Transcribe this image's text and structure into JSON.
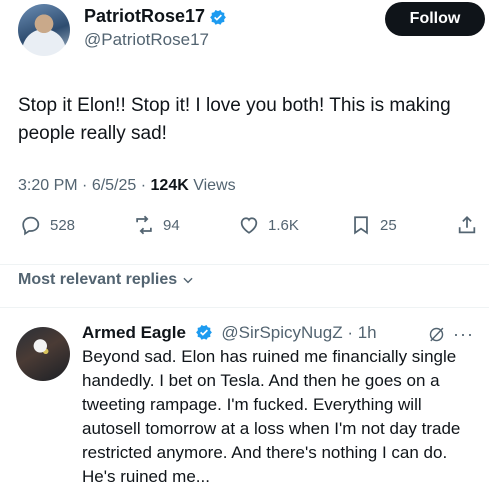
{
  "tweet": {
    "author_name": "PatriotRose17",
    "author_handle": "@PatriotRose17",
    "follow_label": "Follow",
    "text": "Stop it Elon!!  Stop it! I love you both! This is making people really sad!",
    "time": "3:20 PM",
    "date": "6/5/25",
    "views_count": "124K",
    "views_label": "Views"
  },
  "actions": {
    "replies": "528",
    "reposts": "94",
    "likes": "1.6K",
    "bookmarks": "25"
  },
  "replies_section": {
    "sort_label": "Most relevant replies"
  },
  "reply": {
    "author_name": "Armed Eagle",
    "author_handle": "@SirSpicyNugZ",
    "time": "1h",
    "text": "Beyond sad. Elon has ruined me financially single handedly. I bet on Tesla. And then he goes on a tweeting rampage. I'm fucked. Everything will autosell tomorrow at a loss when I'm not day trade restricted anymore. And there's nothing I can do.  He's ruined me..."
  },
  "colors": {
    "verified": "#1d9bf0",
    "muted": "#536471",
    "text": "#0f1419"
  }
}
